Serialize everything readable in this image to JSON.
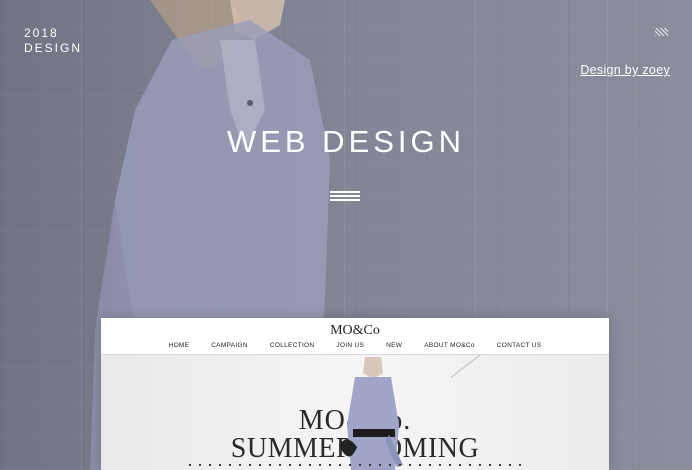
{
  "hero": {
    "year": "2018",
    "tag": "DESIGN",
    "credit": "Design by zoey",
    "title": "WEB DESIGN"
  },
  "mockup": {
    "logo": "MO&Co",
    "nav": [
      "HOME",
      "CAMPAIGN",
      "COLLECTION",
      "JOIN US",
      "NEW",
      "ABOUT MO&Co",
      "CONTACT US"
    ],
    "banner": {
      "line1": "MO&Co.",
      "line2": "SUMMER COMING"
    }
  },
  "colors": {
    "overlay": "#7a7e8d",
    "text": "#ffffff"
  }
}
